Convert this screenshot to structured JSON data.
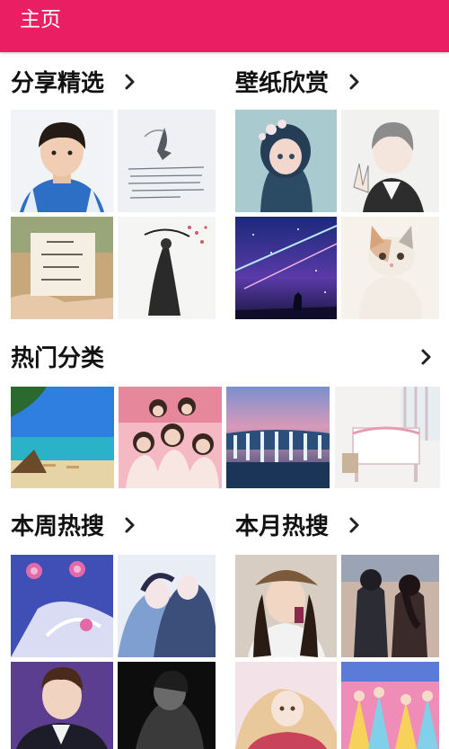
{
  "appbar": {
    "title": "主页"
  },
  "sections": {
    "share": {
      "title": "分享精选"
    },
    "wallpaper": {
      "title": "壁纸欣赏"
    },
    "hot": {
      "title": "热门分类"
    },
    "weekly": {
      "title": "本周热搜"
    },
    "monthly": {
      "title": "本月热搜"
    }
  },
  "icons": {
    "more": "chevron-right-icon"
  },
  "colors": {
    "accent": "#e91e63"
  }
}
